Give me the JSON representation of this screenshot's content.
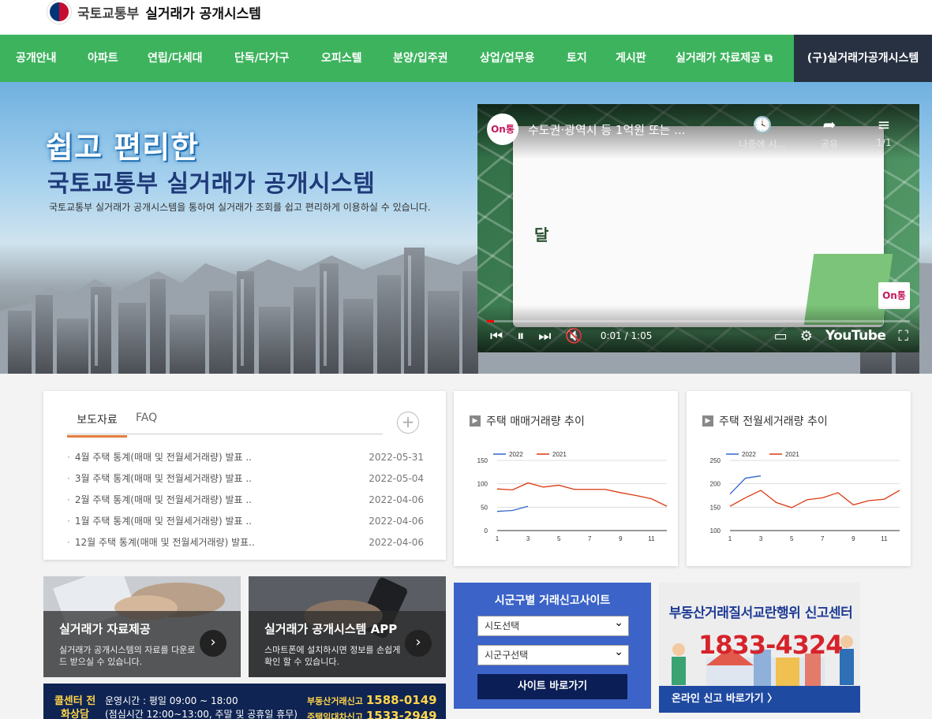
{
  "header": {
    "org": "국토교통부",
    "system": "실거래가 공개시스템"
  },
  "nav": {
    "items": [
      "공개안내",
      "아파트",
      "연립/다세대",
      "단독/다가구",
      "오피스텔",
      "분양/입주권",
      "상업/업무용",
      "토지",
      "게시판",
      "실거래가 자료제공 ⧉"
    ],
    "old_system": "(구)실거래가공개시스템"
  },
  "hero": {
    "line1": "쉽고 편리한",
    "line2": "국토교통부 실거래가 공개시스템",
    "desc": "국토교통부 실거래가 공개시스템을 통하여 실거래가 조회를 쉽고 편리하게 이용하실 수 있습니다."
  },
  "video": {
    "channel": "On통",
    "title": "수도권·광역시 등 1억원 또는 ...",
    "watch_later": "나중에 시...",
    "share": "공유",
    "playlist": "1/1",
    "caption": "달",
    "time": "0:01 / 1:05",
    "progress_fraction": 0.016,
    "brand": "YouTube"
  },
  "news": {
    "tabs": [
      "보도자료",
      "FAQ"
    ],
    "items": [
      {
        "title": "4월 주택 통계(매매 및 전월세거래량) 발표 ..",
        "date": "2022-05-31"
      },
      {
        "title": "3월 주택 통계(매매 및 전월세거래량) 발표 ..",
        "date": "2022-05-04"
      },
      {
        "title": "2월 주택 통계(매매 및 전월세거래량) 발표 ..",
        "date": "2022-04-06"
      },
      {
        "title": "1월 주택 통계(매매 및 전월세거래량) 발표 ..",
        "date": "2022-04-06"
      },
      {
        "title": "12월 주택 통계(매매 및 전월세거래량) 발표..",
        "date": "2022-04-06"
      }
    ]
  },
  "charts": {
    "sale_title": "주택 매매거래량 추이",
    "rent_title": "주택 전월세거래량 추이"
  },
  "chart_data": [
    {
      "type": "line",
      "title": "주택 매매거래량 추이",
      "x": [
        1,
        2,
        3,
        4,
        5,
        6,
        7,
        8,
        9,
        10,
        11,
        12
      ],
      "x_ticks": [
        "1",
        "3",
        "5",
        "7",
        "9",
        "11"
      ],
      "ylim": [
        0,
        150
      ],
      "y_ticks": [
        "0",
        "50",
        "100",
        "150"
      ],
      "legend": "top-left",
      "series": [
        {
          "name": "2022",
          "color": "#3366cc",
          "values": [
            41,
            43,
            52,
            null,
            null,
            null,
            null,
            null,
            null,
            null,
            null,
            null
          ]
        },
        {
          "name": "2021",
          "color": "#dc3912",
          "values": [
            89,
            87,
            102,
            93,
            97,
            88,
            88,
            88,
            81,
            75,
            68,
            52
          ]
        }
      ]
    },
    {
      "type": "line",
      "title": "주택 전월세거래량 추이",
      "x": [
        1,
        2,
        3,
        4,
        5,
        6,
        7,
        8,
        9,
        10,
        11,
        12
      ],
      "x_ticks": [
        "1",
        "3",
        "5",
        "7",
        "9",
        "11"
      ],
      "ylim": [
        100,
        250
      ],
      "y_ticks": [
        "100",
        "150",
        "200",
        "250"
      ],
      "legend": "top-left",
      "series": [
        {
          "name": "2022",
          "color": "#3366cc",
          "values": [
            178,
            212,
            217,
            null,
            null,
            null,
            null,
            null,
            null,
            null,
            null,
            null
          ]
        },
        {
          "name": "2021",
          "color": "#dc3912",
          "values": [
            152,
            170,
            186,
            160,
            149,
            166,
            170,
            181,
            155,
            164,
            167,
            186
          ]
        }
      ]
    }
  ],
  "tiles": [
    {
      "title": "실거래가 자료제공",
      "desc": "실거래가 공개시스템의 자료를 다운로드 받으실 수 있습니다."
    },
    {
      "title": "실거래가 공개시스템 APP",
      "desc": "스마트폰에 설치하시면 정보를 손쉽게 확인 할 수 있습니다."
    }
  ],
  "callcenter": {
    "label": "콜센터 전화상담",
    "hours": "운영시간 : 평일 09:00 ~ 18:00",
    "hours_note": "(점심시간 12:00~13:00, 주말 및 공휴일 휴무)",
    "phone1_label": "부동산거래신고",
    "phone1": "1588-0149",
    "phone2_label": "주택임대차신고",
    "phone2": "1533-2949"
  },
  "report": {
    "title": "시군구별 거래신고사이트",
    "sido": "시도선택",
    "sigungu": "시군구선택",
    "button": "사이트 바로가기"
  },
  "banner": {
    "title": "부동산거래질서교란행위 신고센터",
    "phone": "1833-4324",
    "link": "온라인 신고 바로가기 〉"
  },
  "colors": {
    "nav": "#3db35d",
    "old_nav": "#273142",
    "accent_tab": "#e47d3b",
    "report": "#3b63c8"
  }
}
